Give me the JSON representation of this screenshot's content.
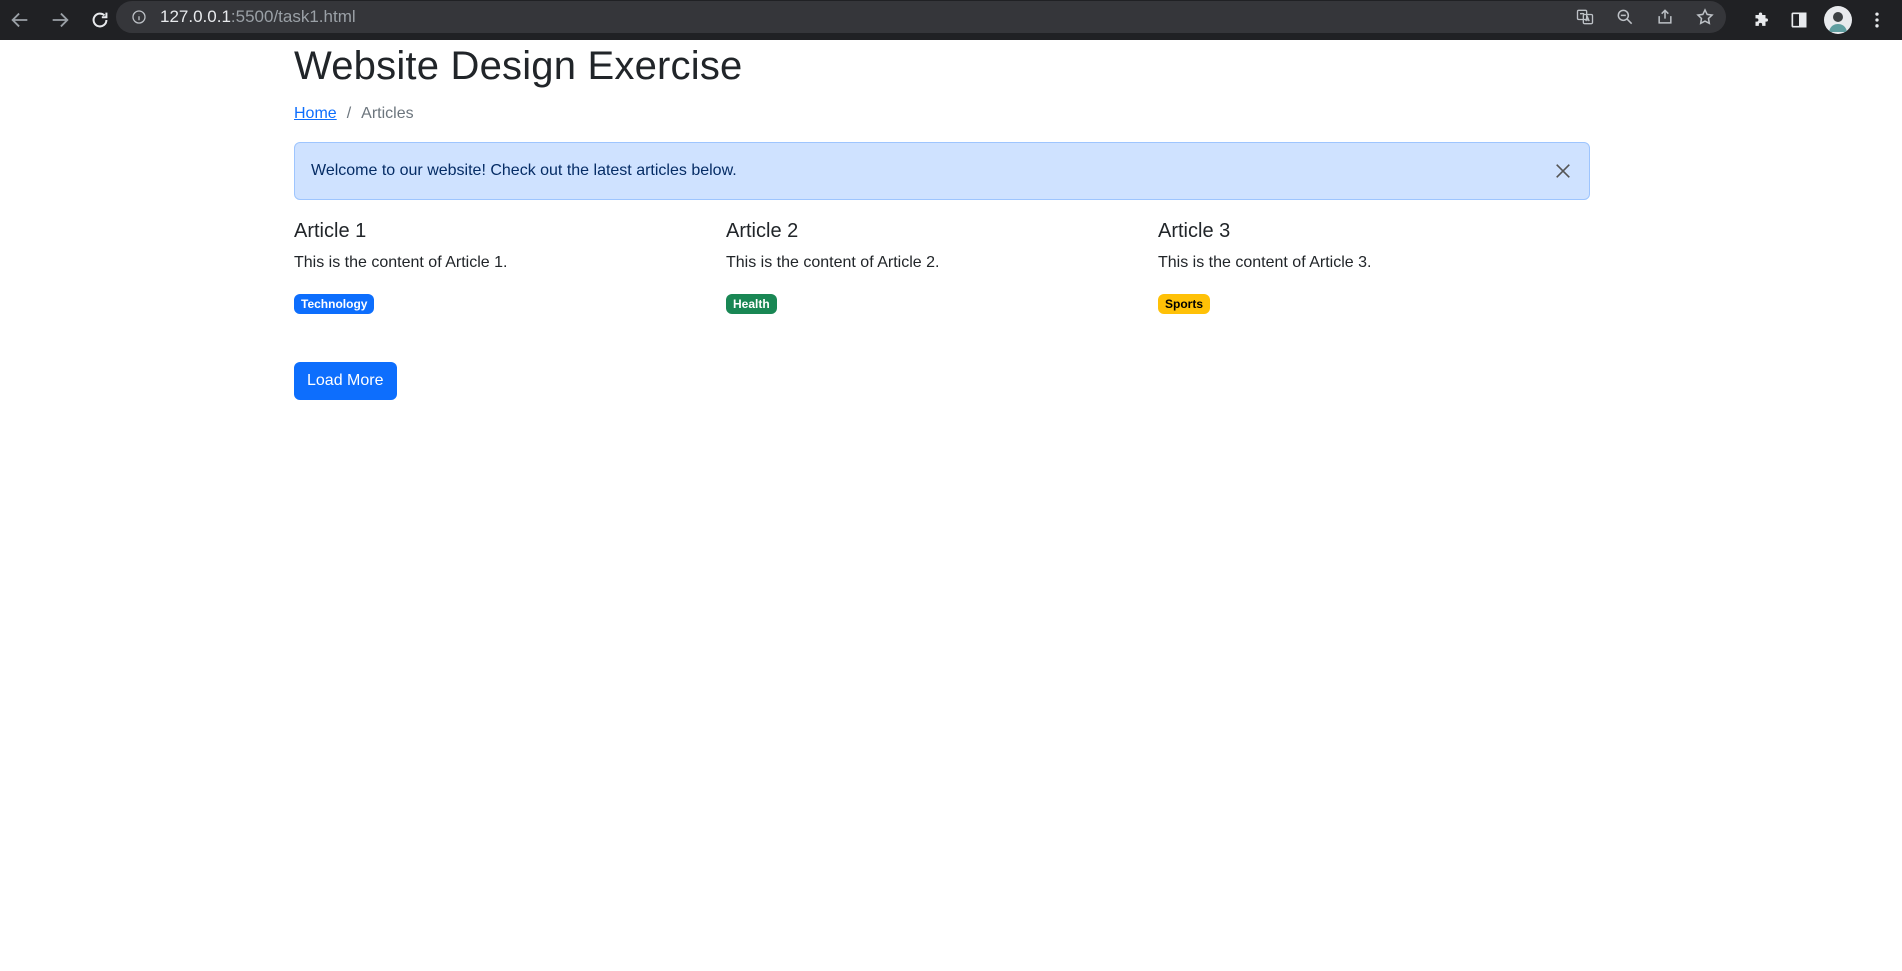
{
  "browser": {
    "url_host": "127.0.0.1",
    "url_path": ":5500/task1.html",
    "nav_icons": [
      "back-icon",
      "forward-icon",
      "reload-icon"
    ],
    "omnibox_icons": [
      "translate-icon",
      "zoom-out-icon",
      "share-icon",
      "bookmark-star-icon"
    ],
    "toolbar_icons": [
      "extensions-icon",
      "side-panel-icon",
      "avatar",
      "menu-icon"
    ]
  },
  "page": {
    "title": "Website Design Exercise"
  },
  "breadcrumb": {
    "home": "Home",
    "separator": "/",
    "current": "Articles"
  },
  "alert": {
    "message": "Welcome to our website! Check out the latest articles below.",
    "close_icon": "close-icon"
  },
  "articles": [
    {
      "title": "Article 1",
      "content": "This is the content of Article 1.",
      "tag": "Technology",
      "tag_color": "#0d6efd"
    },
    {
      "title": "Article 2",
      "content": "This is the content of Article 2.",
      "tag": "Health",
      "tag_color": "#198754"
    },
    {
      "title": "Article 3",
      "content": "This is the content of Article 3.",
      "tag": "Sports",
      "tag_color": "#ffc107"
    }
  ],
  "actions": {
    "load_more": "Load More"
  },
  "colors": {
    "browser_bar": "#202124",
    "omnibox": "#35363a",
    "primary": "#0d6efd",
    "alert_bg": "#cfe2ff"
  }
}
